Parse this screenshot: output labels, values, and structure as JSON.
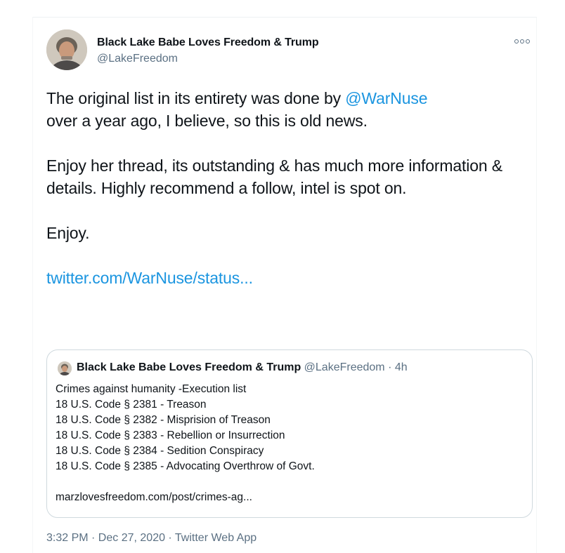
{
  "tweet": {
    "author_name": "Black Lake Babe Loves Freedom & Trump",
    "author_handle": "@LakeFreedom",
    "more_icon": "more-dots-icon",
    "text_line1_before": "The original list in its entirety was done by ",
    "text_line1_mention": "@WarNuse",
    "text_line2": "over a year ago, I believe, so this is old news.",
    "text_para2": "Enjoy her thread, its outstanding & has much more information & details.  Highly recommend a follow, intel is spot on.",
    "text_para3": "Enjoy.",
    "link": "twitter.com/WarNuse/status...",
    "timestamp": "3:32 PM · Dec 27, 2020 · Twitter Web App"
  },
  "quote": {
    "author_name": "Black Lake Babe Loves Freedom & Trump",
    "author_meta": " @LakeFreedom · 4h",
    "lines": [
      "Crimes against humanity -Execution list",
      "18 U.S. Code § 2381 - Treason",
      "18 U.S. Code § 2382 - Misprision of Treason",
      "18 U.S. Code § 2383 - Rebellion or Insurrection",
      "18 U.S. Code § 2384 - Sedition Conspiracy",
      "18 U.S. Code § 2385 - Advocating Overthrow of Govt."
    ],
    "link": "marzlovesfreedom.com/post/crimes-ag..."
  },
  "colors": {
    "accent": "#1b95e0",
    "secondary_text": "#5b7083",
    "border": "#cfd9de"
  }
}
